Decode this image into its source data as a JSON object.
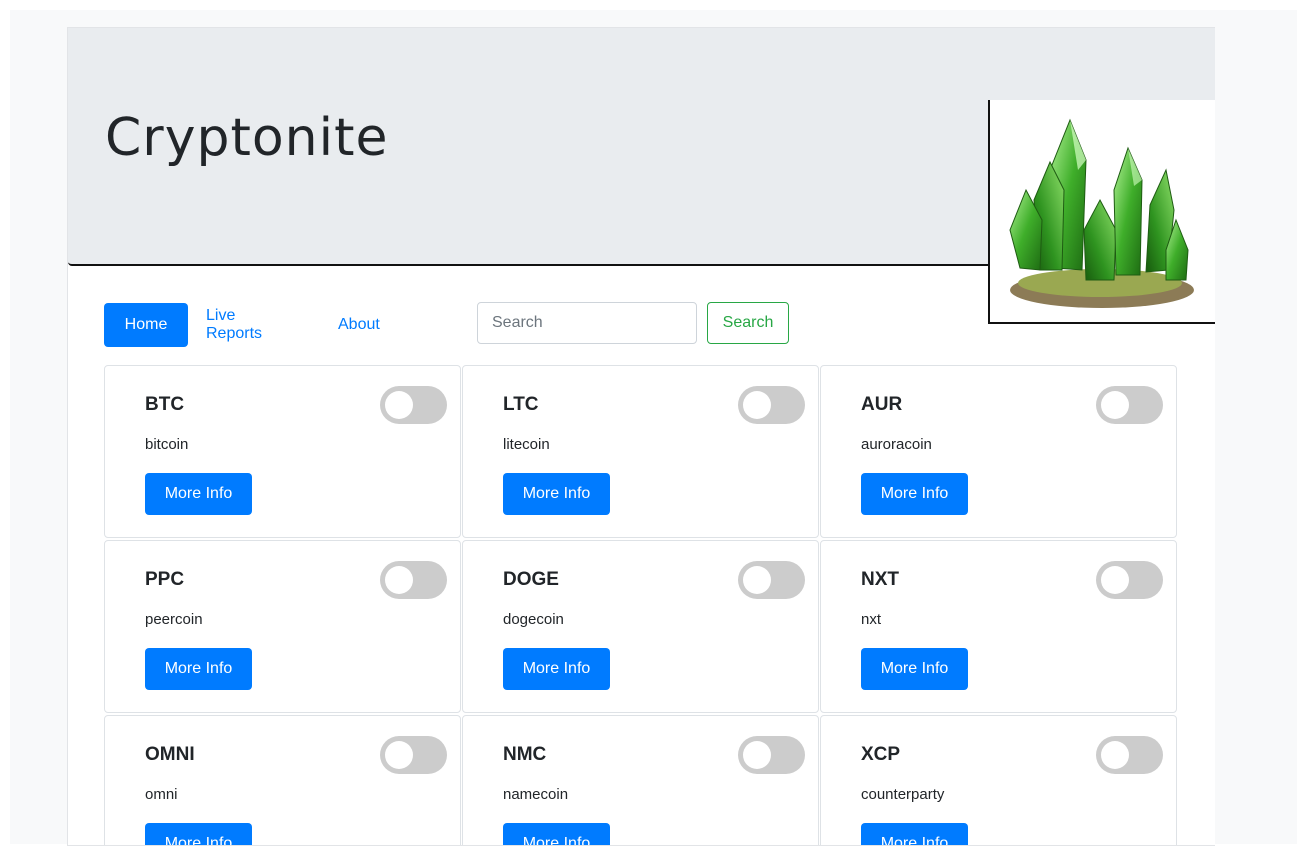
{
  "header": {
    "title": "Cryptonite",
    "logo_icon": "green-crystal-logo"
  },
  "nav": {
    "home": "Home",
    "live_reports": "Live Reports",
    "about": "About"
  },
  "search": {
    "placeholder": "Search",
    "button_label": "Search"
  },
  "colors": {
    "primary": "#007bff",
    "success": "#28a745",
    "jumbotron": "#e9ecef"
  },
  "coins": [
    {
      "symbol": "BTC",
      "name": "bitcoin",
      "button": "More Info",
      "toggle_on": false
    },
    {
      "symbol": "LTC",
      "name": "litecoin",
      "button": "More Info",
      "toggle_on": false
    },
    {
      "symbol": "AUR",
      "name": "auroracoin",
      "button": "More Info",
      "toggle_on": false
    },
    {
      "symbol": "PPC",
      "name": "peercoin",
      "button": "More Info",
      "toggle_on": false
    },
    {
      "symbol": "DOGE",
      "name": "dogecoin",
      "button": "More Info",
      "toggle_on": false
    },
    {
      "symbol": "NXT",
      "name": "nxt",
      "button": "More Info",
      "toggle_on": false
    },
    {
      "symbol": "OMNI",
      "name": "omni",
      "button": "More Info",
      "toggle_on": false
    },
    {
      "symbol": "NMC",
      "name": "namecoin",
      "button": "More Info",
      "toggle_on": false
    },
    {
      "symbol": "XCP",
      "name": "counterparty",
      "button": "More Info",
      "toggle_on": false
    }
  ]
}
